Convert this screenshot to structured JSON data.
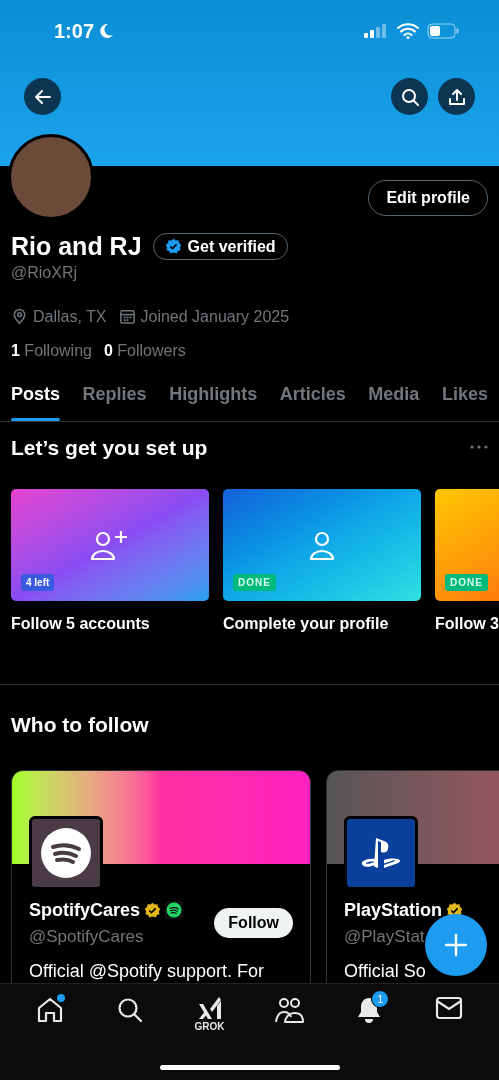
{
  "status_bar": {
    "time": "1:07"
  },
  "profile": {
    "name": "Rio and RJ",
    "verify_button": "Get verified",
    "handle": "@RioXRj",
    "location": "Dallas, TX",
    "joined": "Joined January 2025",
    "following_count": "1",
    "following_label": "Following",
    "followers_count": "0",
    "followers_label": "Followers",
    "edit_button": "Edit profile"
  },
  "tabs": [
    {
      "label": "Posts",
      "selected": true
    },
    {
      "label": "Replies",
      "selected": false
    },
    {
      "label": "Highlights",
      "selected": false
    },
    {
      "label": "Articles",
      "selected": false
    },
    {
      "label": "Media",
      "selected": false
    },
    {
      "label": "Likes",
      "selected": false
    }
  ],
  "setup": {
    "title": "Let’s get you set up",
    "cards": [
      {
        "kind": "follow",
        "badge": "4 left",
        "done": false,
        "label": "Follow 5 accounts"
      },
      {
        "kind": "profile",
        "badge": "DONE",
        "done": true,
        "label": "Complete your profile"
      },
      {
        "kind": "other",
        "badge": "DONE",
        "done": true,
        "label": "Follow 3"
      }
    ]
  },
  "who_to_follow": {
    "title": "Who to follow",
    "accounts": [
      {
        "kind": "spotify",
        "name": "SpotifyCares",
        "verified": true,
        "handle": "@SpotifyCares",
        "follow_button": "Follow",
        "bio": "Official @Spotify support. For"
      },
      {
        "kind": "playstation",
        "name": "PlayStation",
        "verified": true,
        "handle": "@PlayStat",
        "bio": "Official So"
      }
    ]
  },
  "nav": [
    {
      "kind": "home",
      "dot": true
    },
    {
      "kind": "search"
    },
    {
      "kind": "grok",
      "label": "GROK"
    },
    {
      "kind": "people"
    },
    {
      "kind": "bell",
      "badge": "1"
    },
    {
      "kind": "mail"
    }
  ]
}
